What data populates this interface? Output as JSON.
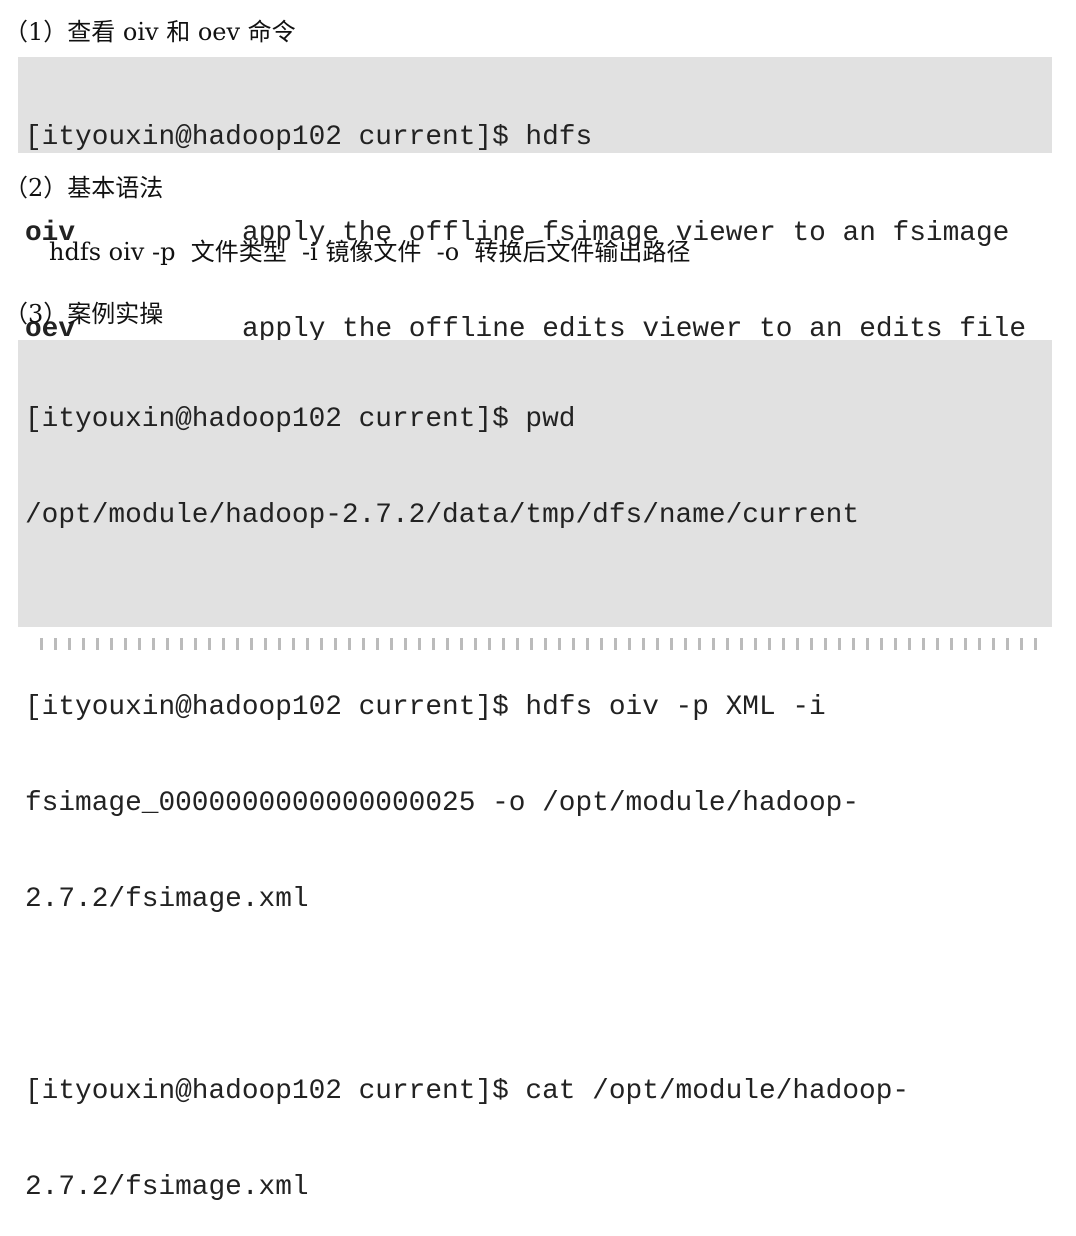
{
  "sections": [
    {
      "heading": "（1）查看 oiv 和 oev 命令"
    },
    {
      "heading": "（2）基本语法",
      "syntax": "hdfs oiv -p  文件类型  -i 镜像文件  -o  转换后文件输出路径"
    },
    {
      "heading": "（3）案例实操"
    }
  ],
  "code1": {
    "prompt": "[ityouxin@hadoop102 current]$ hdfs",
    "commands": [
      {
        "name": "oiv",
        "desc": "apply the offline fsimage viewer to an fsimage"
      },
      {
        "name": "oev",
        "desc": "apply the offline edits viewer to an edits file"
      }
    ]
  },
  "code2": {
    "lines": [
      "[ityouxin@hadoop102 current]$ pwd",
      "/opt/module/hadoop-2.7.2/data/tmp/dfs/name/current",
      "",
      "[ityouxin@hadoop102 current]$ hdfs oiv -p XML -i",
      "fsimage_0000000000000000025 -o /opt/module/hadoop-",
      "2.7.2/fsimage.xml",
      "",
      "[ityouxin@hadoop102 current]$ cat /opt/module/hadoop-",
      "2.7.2/fsimage.xml"
    ]
  }
}
